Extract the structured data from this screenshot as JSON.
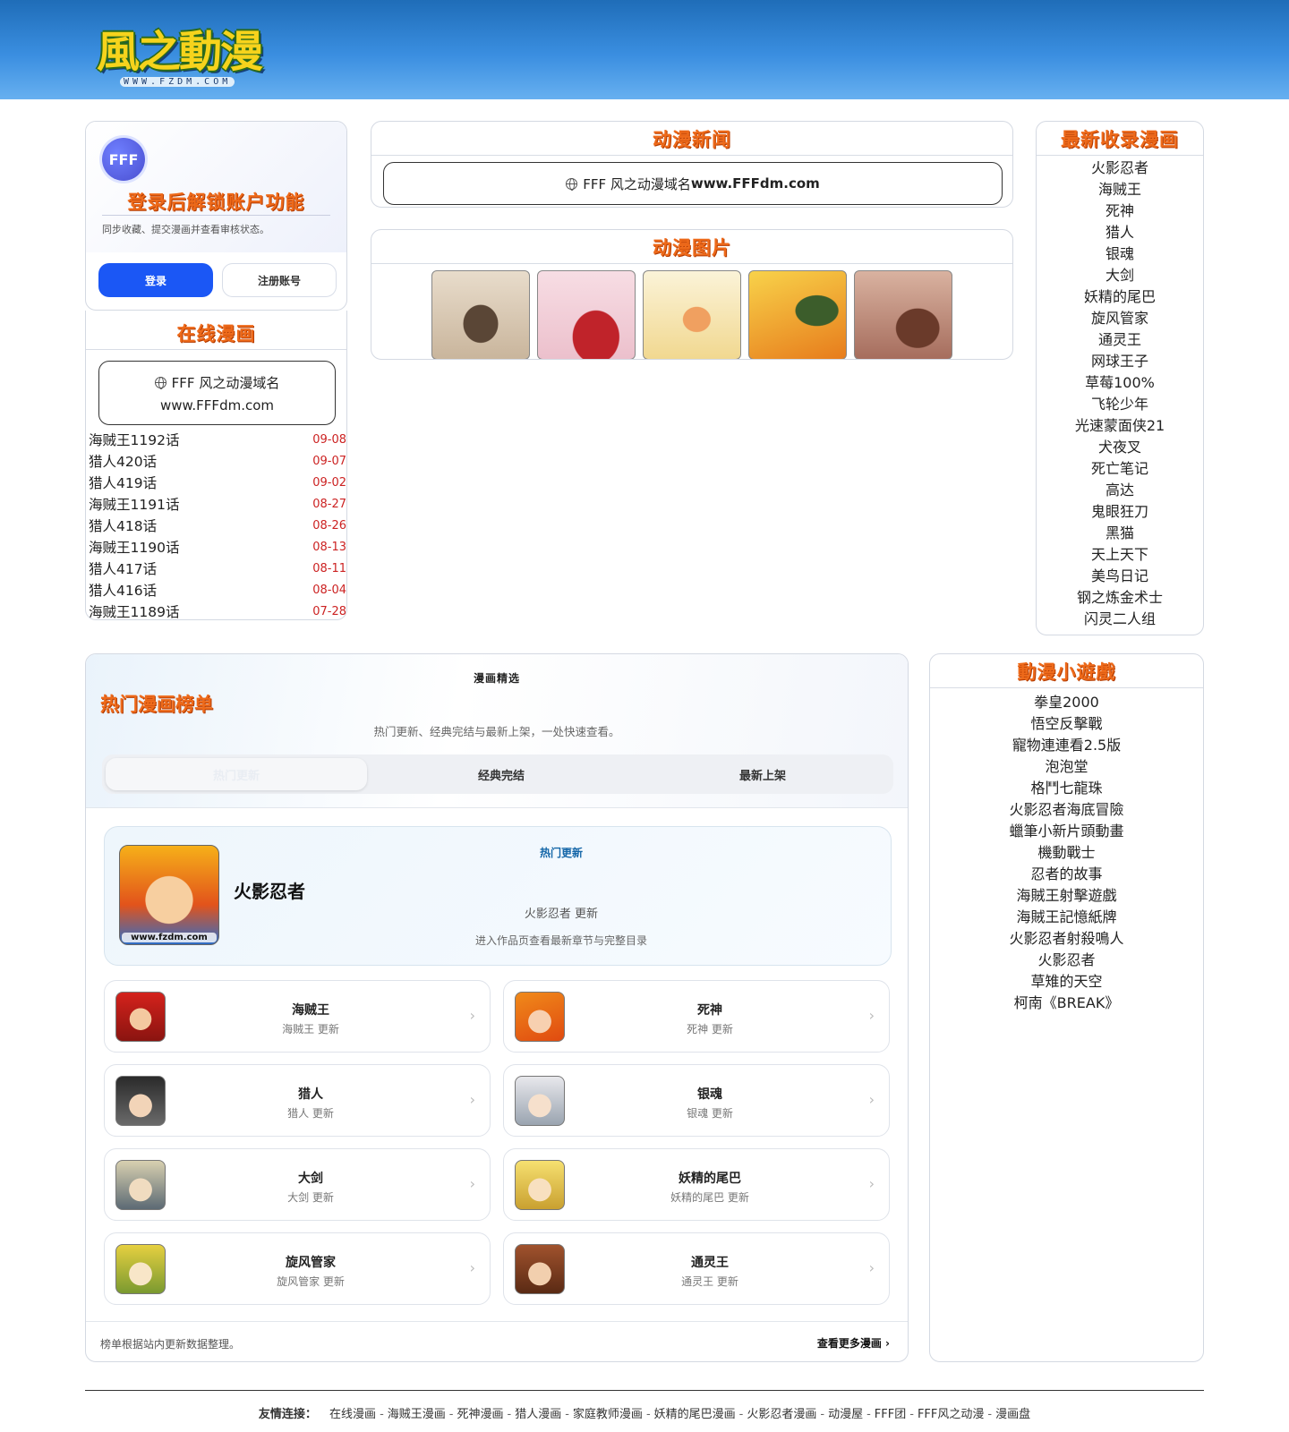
{
  "header": {
    "logo_text": "風之動漫",
    "logo_url": "WWW.FZDM.COM"
  },
  "login": {
    "avatar_text": "FFF",
    "title": "登录后解锁账户功能",
    "desc": "同步收藏、提交漫画并查看审核状态。",
    "login_btn": "登录",
    "register_btn": "注册账号"
  },
  "online": {
    "title": "在线漫画",
    "notice_line1": "FFF 风之动漫域名",
    "notice_line2": "www.FFFdm.com",
    "items": [
      {
        "name": "海贼王1192话",
        "date": "09-08"
      },
      {
        "name": "猎人420话",
        "date": "09-07"
      },
      {
        "name": "猎人419话",
        "date": "09-02"
      },
      {
        "name": "海贼王1191话",
        "date": "08-27"
      },
      {
        "name": "猎人418话",
        "date": "08-26"
      },
      {
        "name": "海贼王1190话",
        "date": "08-13"
      },
      {
        "name": "猎人417话",
        "date": "08-11"
      },
      {
        "name": "猎人416话",
        "date": "08-04"
      },
      {
        "name": "海贼王1189话",
        "date": "07-28"
      }
    ]
  },
  "news": {
    "title": "动漫新闻",
    "notice_prefix": "FFF 风之动漫域名",
    "notice_domain": "www.FFFdm.com"
  },
  "pictures": {
    "title": "动漫图片"
  },
  "latest": {
    "title": "最新收录漫画",
    "items": [
      "火影忍者",
      "海贼王",
      "死神",
      "猎人",
      "银魂",
      "大剑",
      "妖精的尾巴",
      "旋风管家",
      "通灵王",
      "网球王子",
      "草莓100%",
      "飞轮少年",
      "光速蒙面侠21",
      "犬夜叉",
      "死亡笔记",
      "高达",
      "鬼眼狂刀",
      "黑猫",
      "天上天下",
      "美鸟日记",
      "钢之炼金术士",
      "闪灵二人组"
    ]
  },
  "hot": {
    "kicker": "漫画精选",
    "title": "热门漫画榜单",
    "subtitle": "热门更新、经典完结与最新上架，一处快速查看。",
    "tabs": [
      "热门更新",
      "经典完结",
      "最新上架"
    ],
    "featured": {
      "tag": "热门更新",
      "name": "火影忍者",
      "update": "火影忍者 更新",
      "desc": "进入作品页查看最新章节与完整目录",
      "cover_tag": "www.fzdm.com"
    },
    "items": [
      {
        "name": "海贼王",
        "update": "海贼王 更新"
      },
      {
        "name": "死神",
        "update": "死神 更新"
      },
      {
        "name": "猎人",
        "update": "猎人 更新"
      },
      {
        "name": "银魂",
        "update": "银魂 更新"
      },
      {
        "name": "大剑",
        "update": "大剑 更新"
      },
      {
        "name": "妖精的尾巴",
        "update": "妖精的尾巴 更新"
      },
      {
        "name": "旋风管家",
        "update": "旋风管家 更新"
      },
      {
        "name": "通灵王",
        "update": "通灵王 更新"
      }
    ],
    "footer_note": "榜单根据站内更新数据整理。",
    "footer_more": "查看更多漫画"
  },
  "games": {
    "title": "動漫小遊戲",
    "items": [
      "拳皇2000",
      "悟空反擊戰",
      "寵物連連看2.5版",
      "泡泡堂",
      "格鬥七龍珠",
      "火影忍者海底冒險",
      "蠟筆小新片頭動畫",
      "機動戰士",
      "忍者的故事",
      "海賊王射擊遊戲",
      "海賊王記憶紙牌",
      "火影忍者射殺鳴人",
      "火影忍者",
      "草雉的天空",
      "柯南《BREAK》"
    ]
  },
  "footer": {
    "label": "友情连接：",
    "links": [
      "在线漫画",
      "海贼王漫画",
      "死神漫画",
      "猎人漫画",
      "家庭教师漫画",
      "妖精的尾巴漫画",
      "火影忍者漫画",
      "动漫屋",
      "FFF团",
      "FFF风之动漫",
      "漫画盘"
    ]
  },
  "colors": {
    "accent": "#ee6a1a",
    "primary_button": "#1b57f5",
    "header_blue": "#2d7fd0",
    "date_red": "#cc2222"
  }
}
